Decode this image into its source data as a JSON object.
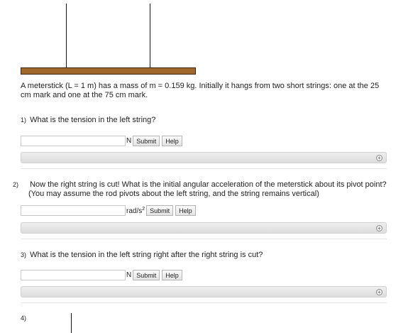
{
  "problem": {
    "text": "A meterstick (L = 1 m) has a mass of m = 0.159 kg. Initially it hangs from two short strings: one at the 25 cm mark and one at the 75 cm mark."
  },
  "questions": [
    {
      "number": "1)",
      "text": "What is the tension in the left string?",
      "unit": "N",
      "input_value": "",
      "submit_label": "Submit",
      "help_label": "Help"
    },
    {
      "number": "2)",
      "text": "Now the right string is cut! What is the initial angular acceleration of the meterstick about its pivot point? (You may assume the rod pivots about the left string, and the string remains vertical)",
      "unit": "rad/s",
      "unit_exp": "2",
      "input_value": "",
      "submit_label": "Submit",
      "help_label": "Help"
    },
    {
      "number": "3)",
      "text": "What is the tension in the left string right after the right string is cut?",
      "unit": "N",
      "input_value": "",
      "submit_label": "Submit",
      "help_label": "Help"
    },
    {
      "number": "4)",
      "text": ""
    }
  ],
  "hint_icon": "plus-circle-icon",
  "colors": {
    "stick": "#a0682a",
    "hint_bar": "#e6e6e6"
  }
}
